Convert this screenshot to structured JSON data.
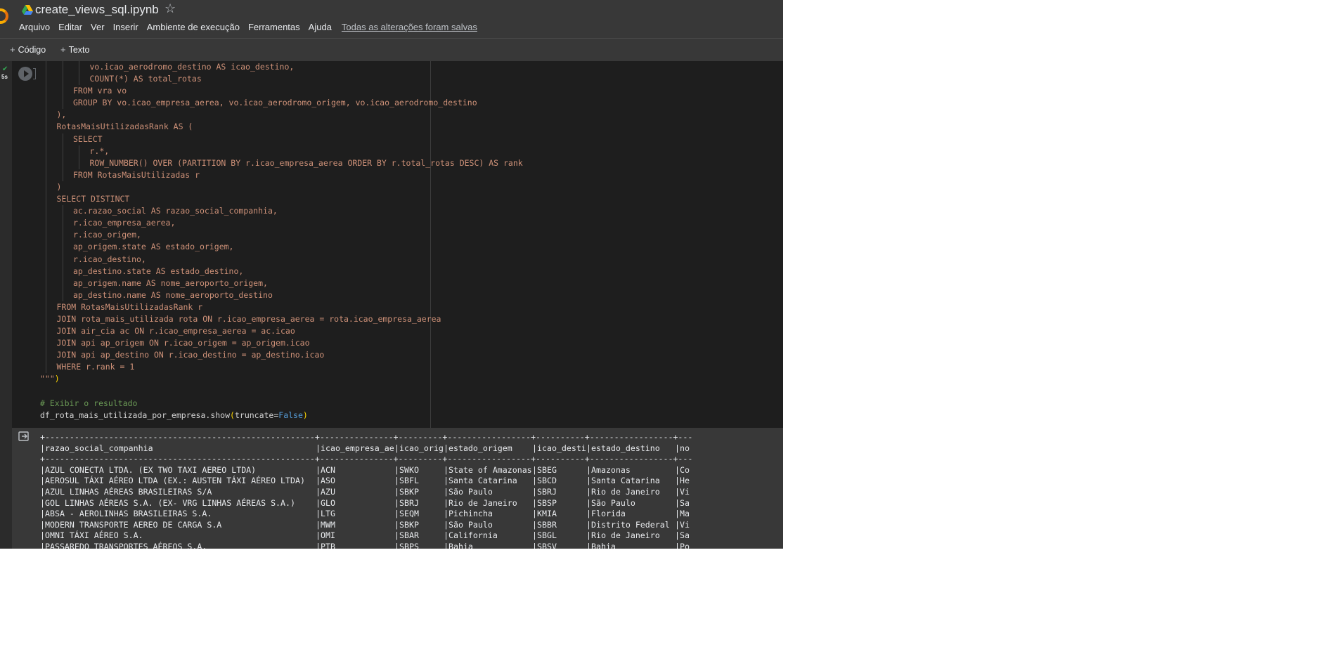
{
  "header": {
    "title": "create_views_sql.ipynb",
    "menu": [
      "Arquivo",
      "Editar",
      "Ver",
      "Inserir",
      "Ambiente de execução",
      "Ferramentas",
      "Ajuda"
    ],
    "save_status": "Todas as alterações foram salvas"
  },
  "toolbar": {
    "code_label": "Código",
    "text_label": "Texto"
  },
  "cell": {
    "exec_time": "5s"
  },
  "code_lines": [
    {
      "indent": 3,
      "parts": [
        {
          "t": "vo.icao_aerodromo_destino AS icao_destino,",
          "c": "s"
        }
      ]
    },
    {
      "indent": 3,
      "parts": [
        {
          "t": "COUNT(*) AS total_rotas",
          "c": "s"
        }
      ]
    },
    {
      "indent": 2,
      "parts": [
        {
          "t": "FROM vra vo",
          "c": "s"
        }
      ]
    },
    {
      "indent": 2,
      "parts": [
        {
          "t": "GROUP BY vo.icao_empresa_aerea, vo.icao_aerodromo_origem, vo.icao_aerodromo_destino",
          "c": "s"
        }
      ]
    },
    {
      "indent": 1,
      "parts": [
        {
          "t": "),",
          "c": "s"
        }
      ]
    },
    {
      "indent": 1,
      "parts": [
        {
          "t": "RotasMaisUtilizadasRank AS (",
          "c": "s"
        }
      ]
    },
    {
      "indent": 2,
      "parts": [
        {
          "t": "SELECT",
          "c": "s"
        }
      ]
    },
    {
      "indent": 3,
      "parts": [
        {
          "t": "r.*,",
          "c": "s"
        }
      ]
    },
    {
      "indent": 3,
      "parts": [
        {
          "t": "ROW_NUMBER() OVER (PARTITION BY r.icao_empresa_aerea ORDER BY r.total_rotas DESC) AS rank",
          "c": "s"
        }
      ]
    },
    {
      "indent": 2,
      "parts": [
        {
          "t": "FROM RotasMaisUtilizadas r",
          "c": "s"
        }
      ]
    },
    {
      "indent": 1,
      "parts": [
        {
          "t": ")",
          "c": "s"
        }
      ]
    },
    {
      "indent": 1,
      "parts": [
        {
          "t": "SELECT DISTINCT",
          "c": "s"
        }
      ]
    },
    {
      "indent": 2,
      "parts": [
        {
          "t": "ac.razao_social AS razao_social_companhia,",
          "c": "s"
        }
      ]
    },
    {
      "indent": 2,
      "parts": [
        {
          "t": "r.icao_empresa_aerea,",
          "c": "s"
        }
      ]
    },
    {
      "indent": 2,
      "parts": [
        {
          "t": "r.icao_origem,",
          "c": "s"
        }
      ]
    },
    {
      "indent": 2,
      "parts": [
        {
          "t": "ap_origem.state AS estado_origem,",
          "c": "s"
        }
      ]
    },
    {
      "indent": 2,
      "parts": [
        {
          "t": "r.icao_destino,",
          "c": "s"
        }
      ]
    },
    {
      "indent": 2,
      "parts": [
        {
          "t": "ap_destino.state AS estado_destino,",
          "c": "s"
        }
      ]
    },
    {
      "indent": 2,
      "parts": [
        {
          "t": "ap_origem.name AS nome_aeroporto_origem,",
          "c": "s"
        }
      ]
    },
    {
      "indent": 2,
      "parts": [
        {
          "t": "ap_destino.name AS nome_aeroporto_destino",
          "c": "s"
        }
      ]
    },
    {
      "indent": 1,
      "parts": [
        {
          "t": "FROM RotasMaisUtilizadasRank r",
          "c": "s"
        }
      ]
    },
    {
      "indent": 1,
      "parts": [
        {
          "t": "JOIN rota_mais_utilizada rota ON r.icao_empresa_aerea = rota.icao_empresa_aerea",
          "c": "s"
        }
      ]
    },
    {
      "indent": 1,
      "parts": [
        {
          "t": "JOIN air_cia ac ON r.icao_empresa_aerea = ac.icao",
          "c": "s"
        }
      ]
    },
    {
      "indent": 1,
      "parts": [
        {
          "t": "JOIN api ap_origem ON r.icao_origem = ap_origem.icao",
          "c": "s"
        }
      ]
    },
    {
      "indent": 1,
      "parts": [
        {
          "t": "JOIN api ap_destino ON r.icao_destino = ap_destino.icao",
          "c": "s"
        }
      ]
    },
    {
      "indent": 1,
      "parts": [
        {
          "t": "WHERE r.rank = 1",
          "c": "s"
        }
      ]
    },
    {
      "indent": 0,
      "parts": [
        {
          "t": "\"\"\"",
          "c": "s"
        },
        {
          "t": ")",
          "c": "p"
        }
      ]
    },
    {
      "indent": 0,
      "parts": []
    },
    {
      "indent": 0,
      "parts": [
        {
          "t": "# Exibir o resultado",
          "c": "m"
        }
      ]
    },
    {
      "indent": 0,
      "parts": [
        {
          "t": "df_rota_mais_utilizada_por_empresa.show",
          "c": "d"
        },
        {
          "t": "(",
          "c": "p"
        },
        {
          "t": "truncate=",
          "c": "d"
        },
        {
          "t": "False",
          "c": "k"
        },
        {
          "t": ")",
          "c": "p"
        }
      ]
    }
  ],
  "output": {
    "columns": [
      "razao_social_companhia",
      "icao_empresa_aerea",
      "icao_origem",
      "estado_origem",
      "icao_destino",
      "estado_destino",
      "no"
    ],
    "rows": [
      [
        "AZUL CONECTA LTDA. (EX TWO TAXI AEREO LTDA)",
        "ACN",
        "SWKO",
        "State of Amazonas",
        "SBEG",
        "Amazonas",
        "Co"
      ],
      [
        "AEROSUL TÁXI AÉREO LTDA (EX.: AUSTEN TÁXI AÉREO LTDA)",
        "ASO",
        "SBFL",
        "Santa Catarina",
        "SBCD",
        "Santa Catarina",
        "He"
      ],
      [
        "AZUL LINHAS AÉREAS BRASILEIRAS S/A",
        "AZU",
        "SBKP",
        "São Paulo",
        "SBRJ",
        "Rio de Janeiro",
        "Vi"
      ],
      [
        "GOL LINHAS AÉREAS S.A. (EX- VRG LINHAS AÉREAS S.A.)",
        "GLO",
        "SBRJ",
        "Rio de Janeiro",
        "SBSP",
        "São Paulo",
        "Sa"
      ],
      [
        "ABSA - AEROLINHAS BRASILEIRAS S.A.",
        "LTG",
        "SEQM",
        "Pichincha",
        "KMIA",
        "Florida",
        "Ma"
      ],
      [
        "MODERN TRANSPORTE AEREO DE CARGA S.A",
        "MWM",
        "SBKP",
        "São Paulo",
        "SBBR",
        "Distrito Federal",
        "Vi"
      ],
      [
        "OMNI TÁXI AÉREO S.A.",
        "OMI",
        "SBAR",
        "California",
        "SBGL",
        "Rio de Janeiro",
        "Sa"
      ],
      [
        "PASSAREDO TRANSPORTES AÉREOS S.A.",
        "PTB",
        "SBPS",
        "Bahia",
        "SBSV",
        "Bahia",
        "Po"
      ]
    ]
  }
}
